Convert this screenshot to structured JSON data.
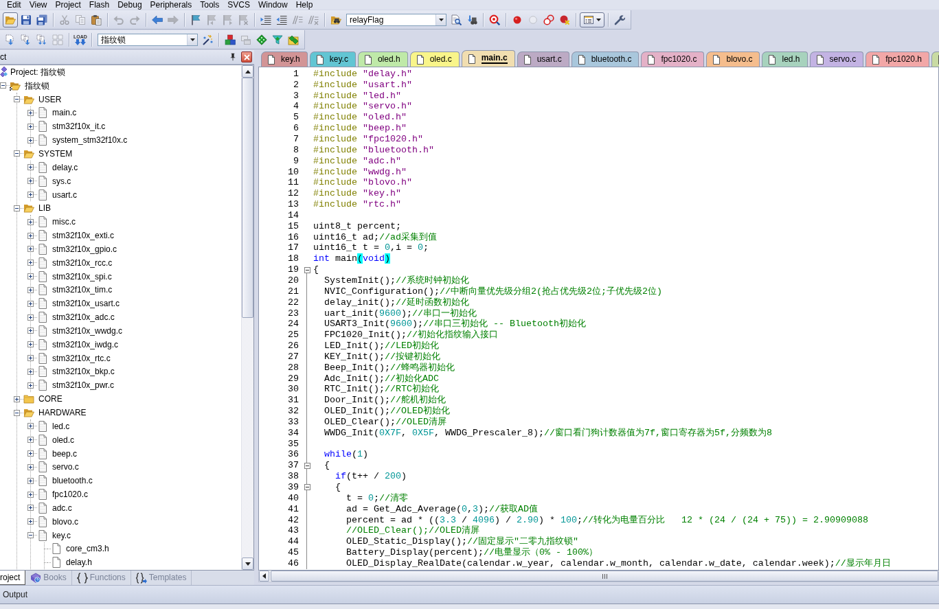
{
  "menu_bar": [
    "Edit",
    "View",
    "Project",
    "Flash",
    "Debug",
    "Peripherals",
    "Tools",
    "SVCS",
    "Window",
    "Help"
  ],
  "toolbars": [
    {
      "groups": [
        [
          {
            "kind": "open",
            "disabled": false,
            "pressed": true
          },
          {
            "kind": "save",
            "disabled": false,
            "pressed": false
          },
          {
            "kind": "save_all",
            "disabled": false,
            "pressed": false
          }
        ],
        [
          {
            "kind": "cut",
            "disabled": true,
            "pressed": false
          },
          {
            "kind": "copy",
            "disabled": true,
            "pressed": false
          },
          {
            "kind": "paste",
            "disabled": false,
            "pressed": false
          }
        ],
        [
          {
            "kind": "undo",
            "disabled": true,
            "pressed": false
          },
          {
            "kind": "redo",
            "disabled": true,
            "pressed": false
          }
        ],
        [
          {
            "kind": "back",
            "disabled": false,
            "pressed": false
          },
          {
            "kind": "forward",
            "disabled": true,
            "pressed": false
          }
        ],
        [
          {
            "kind": "bookmark",
            "disabled": false,
            "pressed": false
          },
          {
            "kind": "prev_bookmark",
            "disabled": true,
            "pressed": false
          },
          {
            "kind": "next_bookmark",
            "disabled": true,
            "pressed": false
          },
          {
            "kind": "clear_bookmarks",
            "disabled": true,
            "pressed": false
          }
        ],
        [
          {
            "kind": "indent",
            "disabled": false,
            "pressed": false
          },
          {
            "kind": "unindent",
            "disabled": false,
            "pressed": false
          },
          {
            "kind": "comment",
            "disabled": true,
            "pressed": false
          },
          {
            "kind": "uncomment",
            "disabled": true,
            "pressed": false
          }
        ],
        [
          {
            "kind": "find_in_files",
            "disabled": false,
            "pressed": false
          },
          {
            "kind": "combo",
            "value": "relayFlag",
            "disabled": false,
            "pressed": false
          },
          {
            "kind": "find",
            "disabled": false,
            "pressed": false
          },
          {
            "kind": "incremental_find",
            "disabled": false,
            "pressed": false
          }
        ],
        [
          {
            "kind": "debug",
            "disabled": false,
            "pressed": false
          }
        ],
        [
          {
            "kind": "breakpoint",
            "disabled": false,
            "pressed": false
          },
          {
            "kind": "disable_breakpoint",
            "disabled": true,
            "pressed": false
          },
          {
            "kind": "disable_all_breakpoints",
            "disabled": false,
            "pressed": false
          },
          {
            "kind": "kill_breakpoints",
            "disabled": false,
            "pressed": false
          }
        ],
        [
          {
            "kind": "window_menu",
            "disabled": false,
            "pressed": true
          }
        ],
        [
          {
            "kind": "configure",
            "disabled": false,
            "pressed": false
          }
        ]
      ]
    },
    {
      "groups": [
        [
          {
            "kind": "translate",
            "disabled": false,
            "pressed": false
          },
          {
            "kind": "build",
            "disabled": false,
            "pressed": false
          },
          {
            "kind": "rebuild",
            "disabled": false,
            "pressed": false
          },
          {
            "kind": "batch_build",
            "disabled": true,
            "pressed": false
          }
        ],
        [
          {
            "kind": "load",
            "label": "LOAD",
            "disabled": false,
            "pressed": false
          }
        ],
        [
          {
            "kind": "combo",
            "value": "指纹锁",
            "disabled": false,
            "pressed": false
          },
          {
            "kind": "target_options",
            "disabled": false,
            "pressed": false
          }
        ],
        [
          {
            "kind": "manage_components",
            "disabled": false,
            "pressed": false
          },
          {
            "kind": "stacked_windows",
            "disabled": true,
            "pressed": false
          },
          {
            "kind": "diamond",
            "disabled": false,
            "pressed": false
          },
          {
            "kind": "funnel",
            "disabled": false,
            "pressed": false
          },
          {
            "kind": "diamond_pack",
            "disabled": false,
            "pressed": false
          }
        ]
      ]
    }
  ],
  "project_panel": {
    "title": "ct",
    "tree": {
      "label": "Project: 指纹锁",
      "kind": "project",
      "children": [
        {
          "label": "指纹锁",
          "kind": "target",
          "expanded": true,
          "children": [
            {
              "label": "USER",
              "kind": "folder",
              "expanded": true,
              "children": [
                {
                  "label": "main.c",
                  "kind": "file",
                  "expanded": false
                },
                {
                  "label": "stm32f10x_it.c",
                  "kind": "file",
                  "expanded": false
                },
                {
                  "label": "system_stm32f10x.c",
                  "kind": "file",
                  "expanded": false
                }
              ]
            },
            {
              "label": "SYSTEM",
              "kind": "folder",
              "expanded": true,
              "children": [
                {
                  "label": "delay.c",
                  "kind": "file",
                  "expanded": false
                },
                {
                  "label": "sys.c",
                  "kind": "file",
                  "expanded": false
                },
                {
                  "label": "usart.c",
                  "kind": "file",
                  "expanded": false
                }
              ]
            },
            {
              "label": "LIB",
              "kind": "folder",
              "expanded": true,
              "children": [
                {
                  "label": "misc.c",
                  "kind": "file",
                  "expanded": false
                },
                {
                  "label": "stm32f10x_exti.c",
                  "kind": "file",
                  "expanded": false
                },
                {
                  "label": "stm32f10x_gpio.c",
                  "kind": "file",
                  "expanded": false
                },
                {
                  "label": "stm32f10x_rcc.c",
                  "kind": "file",
                  "expanded": false
                },
                {
                  "label": "stm32f10x_spi.c",
                  "kind": "file",
                  "expanded": false
                },
                {
                  "label": "stm32f10x_tim.c",
                  "kind": "file",
                  "expanded": false
                },
                {
                  "label": "stm32f10x_usart.c",
                  "kind": "file",
                  "expanded": false
                },
                {
                  "label": "stm32f10x_adc.c",
                  "kind": "file",
                  "expanded": false
                },
                {
                  "label": "stm32f10x_wwdg.c",
                  "kind": "file",
                  "expanded": false
                },
                {
                  "label": "stm32f10x_iwdg.c",
                  "kind": "file",
                  "expanded": false
                },
                {
                  "label": "stm32f10x_rtc.c",
                  "kind": "file",
                  "expanded": false
                },
                {
                  "label": "stm32f10x_bkp.c",
                  "kind": "file",
                  "expanded": false
                },
                {
                  "label": "stm32f10x_pwr.c",
                  "kind": "file",
                  "expanded": false
                }
              ]
            },
            {
              "label": "CORE",
              "kind": "folder",
              "expanded": false
            },
            {
              "label": "HARDWARE",
              "kind": "folder",
              "expanded": true,
              "children": [
                {
                  "label": "led.c",
                  "kind": "file",
                  "expanded": false
                },
                {
                  "label": "oled.c",
                  "kind": "file",
                  "expanded": false
                },
                {
                  "label": "beep.c",
                  "kind": "file",
                  "expanded": false
                },
                {
                  "label": "servo.c",
                  "kind": "file",
                  "expanded": false
                },
                {
                  "label": "bluetooth.c",
                  "kind": "file",
                  "expanded": false
                },
                {
                  "label": "fpc1020.c",
                  "kind": "file",
                  "expanded": false
                },
                {
                  "label": "adc.c",
                  "kind": "file",
                  "expanded": false
                },
                {
                  "label": "blovo.c",
                  "kind": "file",
                  "expanded": false
                },
                {
                  "label": "key.c",
                  "kind": "file",
                  "expanded": true,
                  "children": [
                    {
                      "label": "core_cm3.h",
                      "kind": "header"
                    },
                    {
                      "label": "delay.h",
                      "kind": "header"
                    }
                  ]
                }
              ]
            }
          ]
        }
      ]
    },
    "tabs": [
      {
        "label": "roject",
        "kind": "project",
        "selected": true
      },
      {
        "label": "Books",
        "kind": "books",
        "selected": false
      },
      {
        "label": "Functions",
        "kind": "functions",
        "selected": false
      },
      {
        "label": "Templates",
        "kind": "templates",
        "selected": false
      }
    ]
  },
  "editor": {
    "tabs": [
      {
        "label": "key.h",
        "color": "#d29496",
        "selected": false
      },
      {
        "label": "key.c",
        "color": "#62c5d3",
        "selected": false
      },
      {
        "label": "oled.h",
        "color": "#bfe9a8",
        "selected": false
      },
      {
        "label": "oled.c",
        "color": "#f9f58a",
        "selected": false
      },
      {
        "label": "main.c",
        "color": "#f1deb0",
        "selected": true
      },
      {
        "label": "usart.c",
        "color": "#bcaac4",
        "selected": false
      },
      {
        "label": "bluetooth.c",
        "color": "#a9c7dc",
        "selected": false
      },
      {
        "label": "fpc1020.c",
        "color": "#e4b1c7",
        "selected": false
      },
      {
        "label": "blovo.c",
        "color": "#f5bd8d",
        "selected": false
      },
      {
        "label": "led.h",
        "color": "#a7d2bd",
        "selected": false
      },
      {
        "label": "servo.c",
        "color": "#c3b3e3",
        "selected": false
      },
      {
        "label": "fpc1020.h",
        "color": "#f2a7a7",
        "selected": false
      },
      {
        "color": "#c9dba3",
        "selected": false
      }
    ],
    "lines": [
      {
        "number": "1",
        "fold": false,
        "tokens": [
          {
            "kind": "preprocessor",
            "text": "#include "
          },
          {
            "kind": "string",
            "text": "\"delay.h\""
          }
        ]
      },
      {
        "number": "2",
        "fold": false,
        "tokens": [
          {
            "kind": "preprocessor",
            "text": "#include "
          },
          {
            "kind": "string",
            "text": "\"usart.h\""
          }
        ]
      },
      {
        "number": "3",
        "fold": false,
        "tokens": [
          {
            "kind": "preprocessor",
            "text": "#include "
          },
          {
            "kind": "string",
            "text": "\"led.h\""
          }
        ]
      },
      {
        "number": "4",
        "fold": false,
        "tokens": [
          {
            "kind": "preprocessor",
            "text": "#include "
          },
          {
            "kind": "string",
            "text": "\"servo.h\""
          }
        ]
      },
      {
        "number": "5",
        "fold": false,
        "tokens": [
          {
            "kind": "preprocessor",
            "text": "#include "
          },
          {
            "kind": "string",
            "text": "\"oled.h\""
          }
        ]
      },
      {
        "number": "6",
        "fold": false,
        "tokens": [
          {
            "kind": "preprocessor",
            "text": "#include "
          },
          {
            "kind": "string",
            "text": "\"beep.h\""
          }
        ]
      },
      {
        "number": "7",
        "fold": false,
        "tokens": [
          {
            "kind": "preprocessor",
            "text": "#include "
          },
          {
            "kind": "string",
            "text": "\"fpc1020.h\""
          }
        ]
      },
      {
        "number": "8",
        "fold": false,
        "tokens": [
          {
            "kind": "preprocessor",
            "text": "#include "
          },
          {
            "kind": "string",
            "text": "\"bluetooth.h\""
          }
        ]
      },
      {
        "number": "9",
        "fold": false,
        "tokens": [
          {
            "kind": "preprocessor",
            "text": "#include "
          },
          {
            "kind": "string",
            "text": "\"adc.h\""
          }
        ]
      },
      {
        "number": "10",
        "fold": false,
        "tokens": [
          {
            "kind": "preprocessor",
            "text": "#include "
          },
          {
            "kind": "string",
            "text": "\"wwdg.h\""
          }
        ]
      },
      {
        "number": "11",
        "fold": false,
        "tokens": [
          {
            "kind": "preprocessor",
            "text": "#include "
          },
          {
            "kind": "string",
            "text": "\"blovo.h\""
          }
        ]
      },
      {
        "number": "12",
        "fold": false,
        "tokens": [
          {
            "kind": "preprocessor",
            "text": "#include "
          },
          {
            "kind": "string",
            "text": "\"key.h\""
          }
        ]
      },
      {
        "number": "13",
        "fold": false,
        "tokens": [
          {
            "kind": "preprocessor",
            "text": "#include "
          },
          {
            "kind": "string",
            "text": "\"rtc.h\""
          }
        ]
      },
      {
        "number": "14",
        "fold": false
      },
      {
        "number": "15",
        "fold": false,
        "tokens": [
          {
            "kind": "plain",
            "text": "uint8_t percent;"
          }
        ]
      },
      {
        "number": "16",
        "fold": false,
        "tokens": [
          {
            "kind": "plain",
            "text": "uint16_t ad;"
          },
          {
            "kind": "comment",
            "text": "//ad采集到值"
          }
        ]
      },
      {
        "number": "17",
        "fold": false,
        "tokens": [
          {
            "kind": "plain",
            "text": "uint16_t t = "
          },
          {
            "kind": "number",
            "text": "0"
          },
          {
            "kind": "plain",
            "text": ",i = "
          },
          {
            "kind": "number",
            "text": "0"
          },
          {
            "kind": "plain",
            "text": ";"
          }
        ]
      },
      {
        "number": "18",
        "fold": false,
        "tokens": [
          {
            "kind": "keyword",
            "text": "int"
          },
          {
            "kind": "plain",
            "text": " main"
          },
          {
            "kind": "bracket_match",
            "text": "("
          },
          {
            "kind": "keyword",
            "text": "void"
          },
          {
            "kind": "bracket_match",
            "text": ")"
          }
        ]
      },
      {
        "number": "19",
        "fold": true,
        "tokens": [
          {
            "kind": "plain",
            "text": "{"
          }
        ]
      },
      {
        "number": "20",
        "fold": false,
        "tokens": [
          {
            "kind": "plain",
            "text": "  SystemInit();"
          },
          {
            "kind": "comment",
            "text": "//系统时钟初始化"
          }
        ]
      },
      {
        "number": "21",
        "fold": false,
        "tokens": [
          {
            "kind": "plain",
            "text": "  NVIC_Configuration();"
          },
          {
            "kind": "comment",
            "text": "//中断向量优先级分组2(抢占优先级2位;子优先级2位)"
          }
        ]
      },
      {
        "number": "22",
        "fold": false,
        "tokens": [
          {
            "kind": "plain",
            "text": "  delay_init();"
          },
          {
            "kind": "comment",
            "text": "//延时函数初始化"
          }
        ]
      },
      {
        "number": "23",
        "fold": false,
        "tokens": [
          {
            "kind": "plain",
            "text": "  uart_init("
          },
          {
            "kind": "number",
            "text": "9600"
          },
          {
            "kind": "plain",
            "text": ");"
          },
          {
            "kind": "comment",
            "text": "//串口一初始化"
          }
        ]
      },
      {
        "number": "24",
        "fold": false,
        "tokens": [
          {
            "kind": "plain",
            "text": "  USART3_Init("
          },
          {
            "kind": "number",
            "text": "9600"
          },
          {
            "kind": "plain",
            "text": ");"
          },
          {
            "kind": "comment",
            "text": "//串口三初始化 -- Bluetooth初始化"
          }
        ]
      },
      {
        "number": "25",
        "fold": false,
        "tokens": [
          {
            "kind": "plain",
            "text": "  FPC1020_Init();"
          },
          {
            "kind": "comment",
            "text": "//初始化指纹输入接口"
          }
        ]
      },
      {
        "number": "26",
        "fold": false,
        "tokens": [
          {
            "kind": "plain",
            "text": "  LED_Init();"
          },
          {
            "kind": "comment",
            "text": "//LED初始化"
          }
        ]
      },
      {
        "number": "27",
        "fold": false,
        "tokens": [
          {
            "kind": "plain",
            "text": "  KEY_Init();"
          },
          {
            "kind": "comment",
            "text": "//按键初始化"
          }
        ]
      },
      {
        "number": "28",
        "fold": false,
        "tokens": [
          {
            "kind": "plain",
            "text": "  Beep_Init();"
          },
          {
            "kind": "comment",
            "text": "//蜂鸣器初始化"
          }
        ]
      },
      {
        "number": "29",
        "fold": false,
        "tokens": [
          {
            "kind": "plain",
            "text": "  Adc_Init();"
          },
          {
            "kind": "comment",
            "text": "//初始化ADC"
          }
        ]
      },
      {
        "number": "30",
        "fold": false,
        "tokens": [
          {
            "kind": "plain",
            "text": "  RTC_Init();"
          },
          {
            "kind": "comment",
            "text": "//RTC初始化"
          }
        ]
      },
      {
        "number": "31",
        "fold": false,
        "tokens": [
          {
            "kind": "plain",
            "text": "  Door_Init();"
          },
          {
            "kind": "comment",
            "text": "//舵机初始化"
          }
        ]
      },
      {
        "number": "32",
        "fold": false,
        "tokens": [
          {
            "kind": "plain",
            "text": "  OLED_Init();"
          },
          {
            "kind": "comment",
            "text": "//OLED初始化"
          }
        ]
      },
      {
        "number": "33",
        "fold": false,
        "tokens": [
          {
            "kind": "plain",
            "text": "  OLED_Clear();"
          },
          {
            "kind": "comment",
            "text": "//OLED清屏"
          }
        ]
      },
      {
        "number": "34",
        "fold": false,
        "tokens": [
          {
            "kind": "plain",
            "text": "  WWDG_Init("
          },
          {
            "kind": "number",
            "text": "0X7F"
          },
          {
            "kind": "plain",
            "text": ", "
          },
          {
            "kind": "number",
            "text": "0X5F"
          },
          {
            "kind": "plain",
            "text": ", WWDG_Prescaler_8);"
          },
          {
            "kind": "comment",
            "text": "//窗口看门狗计数器值为7f,窗口寄存器为5f,分频数为8"
          }
        ]
      },
      {
        "number": "35",
        "fold": false
      },
      {
        "number": "36",
        "fold": false,
        "tokens": [
          {
            "kind": "keyword",
            "text": "  while"
          },
          {
            "kind": "plain",
            "text": "("
          },
          {
            "kind": "number",
            "text": "1"
          },
          {
            "kind": "plain",
            "text": ")"
          }
        ]
      },
      {
        "number": "37",
        "fold": true,
        "tokens": [
          {
            "kind": "plain",
            "text": "  {"
          }
        ]
      },
      {
        "number": "38",
        "fold": false,
        "tokens": [
          {
            "kind": "keyword",
            "text": "    if"
          },
          {
            "kind": "plain",
            "text": "(t++ / "
          },
          {
            "kind": "number",
            "text": "200"
          },
          {
            "kind": "plain",
            "text": ")"
          }
        ]
      },
      {
        "number": "39",
        "fold": true,
        "tokens": [
          {
            "kind": "plain",
            "text": "    {"
          }
        ]
      },
      {
        "number": "40",
        "fold": false,
        "tokens": [
          {
            "kind": "plain",
            "text": "      t = "
          },
          {
            "kind": "number",
            "text": "0"
          },
          {
            "kind": "plain",
            "text": ";"
          },
          {
            "kind": "comment",
            "text": "//清零"
          }
        ]
      },
      {
        "number": "41",
        "fold": false,
        "tokens": [
          {
            "kind": "plain",
            "text": "      ad = Get_Adc_Average("
          },
          {
            "kind": "number",
            "text": "0"
          },
          {
            "kind": "plain",
            "text": ","
          },
          {
            "kind": "number",
            "text": "3"
          },
          {
            "kind": "plain",
            "text": ");"
          },
          {
            "kind": "comment",
            "text": "//获取AD值"
          }
        ]
      },
      {
        "number": "42",
        "fold": false,
        "tokens": [
          {
            "kind": "plain",
            "text": "      percent = ad * (("
          },
          {
            "kind": "number",
            "text": "3.3"
          },
          {
            "kind": "plain",
            "text": " / "
          },
          {
            "kind": "number",
            "text": "4096"
          },
          {
            "kind": "plain",
            "text": ") / "
          },
          {
            "kind": "number",
            "text": "2.90"
          },
          {
            "kind": "plain",
            "text": ") * "
          },
          {
            "kind": "number",
            "text": "100"
          },
          {
            "kind": "plain",
            "text": ";"
          },
          {
            "kind": "comment",
            "text": "//转化为电量百分比   12 * (24 / (24 + 75)) = 2.90909088"
          }
        ]
      },
      {
        "number": "43",
        "fold": false,
        "tokens": [
          {
            "kind": "comment",
            "text": "      //OLED_Clear();//OLED清屏"
          }
        ]
      },
      {
        "number": "44",
        "fold": false,
        "tokens": [
          {
            "kind": "plain",
            "text": "      OLED_Static_Display();"
          },
          {
            "kind": "comment",
            "text": "//固定显示\"二零九指纹锁\""
          }
        ]
      },
      {
        "number": "45",
        "fold": false,
        "tokens": [
          {
            "kind": "plain",
            "text": "      Battery_Display(percent);"
          },
          {
            "kind": "comment",
            "text": "//电量显示（0% - 100%）"
          }
        ]
      },
      {
        "number": "46",
        "fold": false,
        "tokens": [
          {
            "kind": "plain",
            "text": "      OLED_Display_RealDate(calendar.w_year, calendar.w_month, calendar.w_date, calendar.week);"
          },
          {
            "kind": "comment",
            "text": "//显示年月日"
          }
        ]
      }
    ]
  },
  "output_panel": {
    "title": "Output"
  }
}
